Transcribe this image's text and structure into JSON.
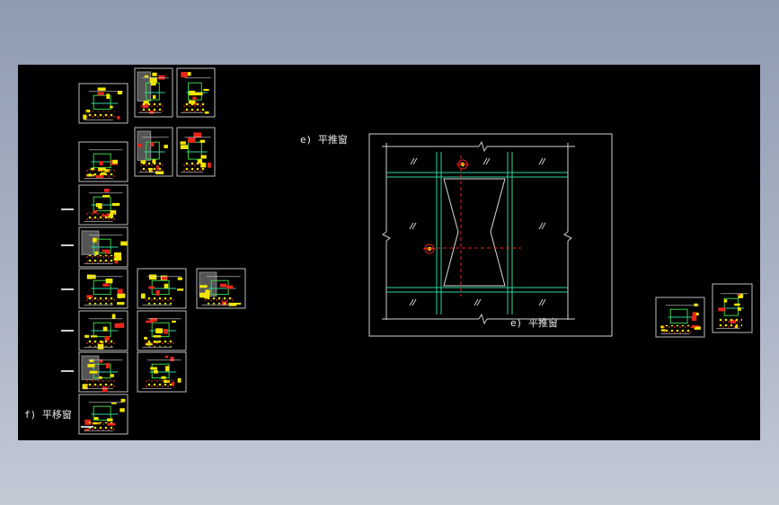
{
  "drawing": {
    "background": "#000000",
    "label_e_top": "e) 平推窗",
    "label_e_bottom": "e) 平推窗",
    "label_f": "f) 平移窗"
  },
  "colors": {
    "frame": "#cfcfcf",
    "mullion": "#2fd3a0",
    "detail_yellow": "#f2e600",
    "detail_red": "#e8261b",
    "detail_green": "#3bd14a",
    "centerline": "#e02020",
    "sash": "#ffffff"
  },
  "icons": {
    "elevation_marker": "target-icon",
    "break_symbol": "break-line-icon",
    "glass_hatch": "hatch-icon"
  }
}
